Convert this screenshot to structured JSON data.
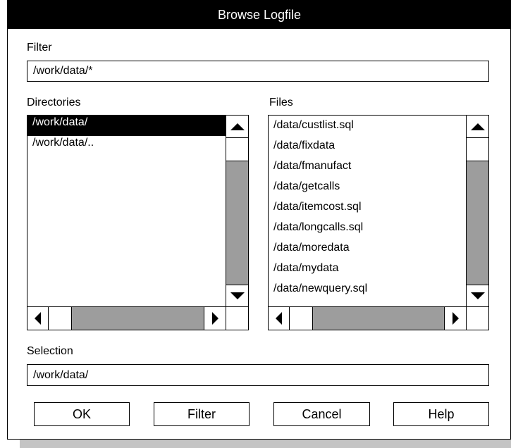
{
  "dialog": {
    "title": "Browse Logfile"
  },
  "filter": {
    "label": "Filter",
    "value": "/work/data/*"
  },
  "directories": {
    "label": "Directories",
    "items": [
      "/work/data/",
      "/work/data/.."
    ],
    "selected_index": 0
  },
  "files": {
    "label": "Files",
    "items": [
      "/data/custlist.sql",
      "/data/fixdata",
      "/data/fmanufact",
      "/data/getcalls",
      "/data/itemcost.sql",
      "/data/longcalls.sql",
      "/data/moredata",
      "/data/mydata",
      "/data/newquery.sql"
    ]
  },
  "selection": {
    "label": "Selection",
    "value": "/work/data/"
  },
  "buttons": {
    "ok": "OK",
    "filter": "Filter",
    "cancel": "Cancel",
    "help": "Help"
  },
  "colors": {
    "titlebar": "#000000",
    "scroll_track": "#9d9d9d",
    "drop_shadow": "#c4c4c4"
  }
}
